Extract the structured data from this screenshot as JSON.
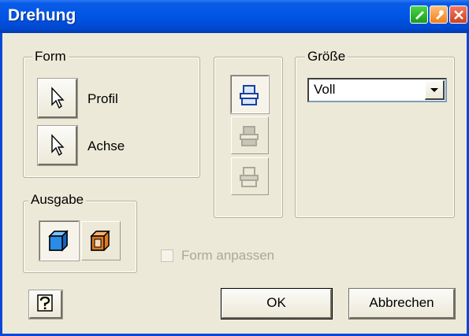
{
  "window": {
    "title": "Drehung"
  },
  "groups": {
    "form": {
      "legend": "Form",
      "profile_label": "Profil",
      "axis_label": "Achse"
    },
    "output": {
      "legend": "Ausgabe"
    },
    "size": {
      "legend": "Größe",
      "selected": "Voll"
    }
  },
  "checkbox": {
    "label": "Form anpassen",
    "checked": false,
    "enabled": false
  },
  "buttons": {
    "ok": "OK",
    "cancel": "Abbrechen"
  },
  "icons": {
    "pick_profile": "cursor-arrow-icon",
    "pick_axis": "cursor-arrow-icon",
    "solid_output": "solid-cube-icon",
    "surface_output": "surface-cube-icon",
    "extents_one": "extents-direction-1-icon",
    "extents_two": "extents-direction-2-icon",
    "extents_sym": "extents-symmetric-icon",
    "help": "help-question-icon"
  },
  "colors": {
    "title_bar": "#0055e5",
    "dialog_bg": "#ece9d8",
    "solid_blue": "#2b8be6",
    "surface_orange": "#e07a20"
  }
}
